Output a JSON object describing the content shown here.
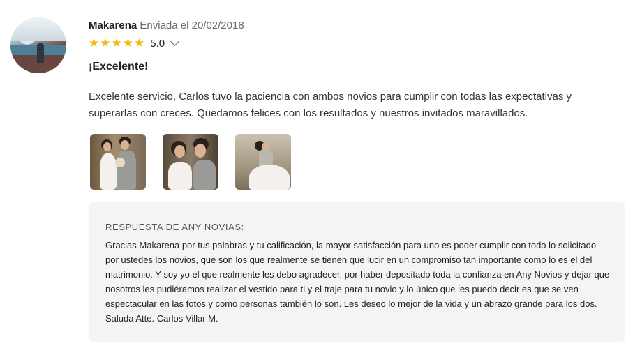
{
  "review": {
    "author": "Makarena",
    "sent_label": "Enviada el 20/02/2018",
    "rating": "5.0",
    "stars": 5,
    "star_color": "#f5b90f",
    "title": "¡Excelente!",
    "body": "Excelente servicio, Carlos tuvo la paciencia con ambos novios para cumplir con todas las expectativas y superarlas con creces. Quedamos felices con los resultados y nuestros invitados maravillados.",
    "photos": [
      {
        "icon": "wedding-photo-couple-standing"
      },
      {
        "icon": "wedding-photo-couple-close"
      },
      {
        "icon": "wedding-photo-couple-kiss"
      }
    ]
  },
  "response": {
    "label": "RESPUESTA DE ANY NOVIAS:",
    "text": "Gracias Makarena por tus palabras y tu calificación, la mayor satisfacción para uno es poder cumplir con todo lo solicitado por ustedes los novios, que son los que realmente se tienen que lucir en un compromiso tan importante como lo es el del matrimonio. Y soy yo el que realmente les debo agradecer, por haber depositado toda la confianza en Any Novios y dejar que nosotros les pudiéramos realizar el vestido para ti y el traje para tu novio y lo único que les puedo decir es que se ven espectacular en las fotos y como personas también lo son. Les deseo lo mejor de la vida y un abrazo grande para los dos. Saluda Atte. Carlos Villar M.",
    "background": "#f4f4f4"
  }
}
